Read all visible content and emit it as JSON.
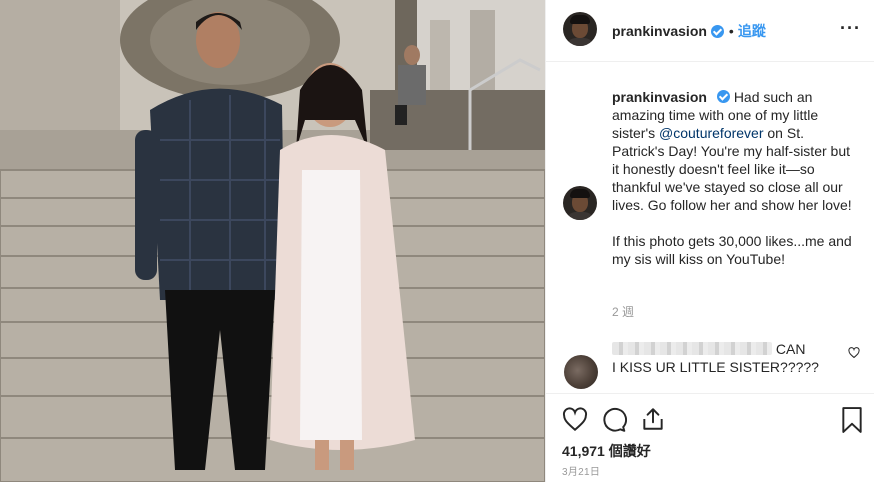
{
  "post": {
    "username": "prankinvasion",
    "follow_label": "追蹤",
    "more_label": "···",
    "caption_part1": "Had such an amazing time with one of my little sister's ",
    "mention": "@coutureforever",
    "caption_part2": " on St. Patrick's Day! You're my half-sister but it honestly doesn't feel like it—so thankful we've stayed so close all our lives. Go follow her and show her love!",
    "caption_paragraph2": "If this photo gets 30,000 likes...me and my sis will kiss on YouTube!",
    "time_ago": "2 週",
    "likes": "41,971 個讚好",
    "date": "3月21日"
  },
  "comment": {
    "text_line1": "CAN",
    "text_line2": "I KISS UR LITTLE SISTER?????"
  },
  "icons": {
    "verified": "verified-badge-icon",
    "like": "heart-icon",
    "comment": "comment-icon",
    "share": "share-icon",
    "save": "bookmark-icon"
  },
  "colors": {
    "accent": "#3897f0",
    "mention": "#003569",
    "muted": "#999999"
  }
}
